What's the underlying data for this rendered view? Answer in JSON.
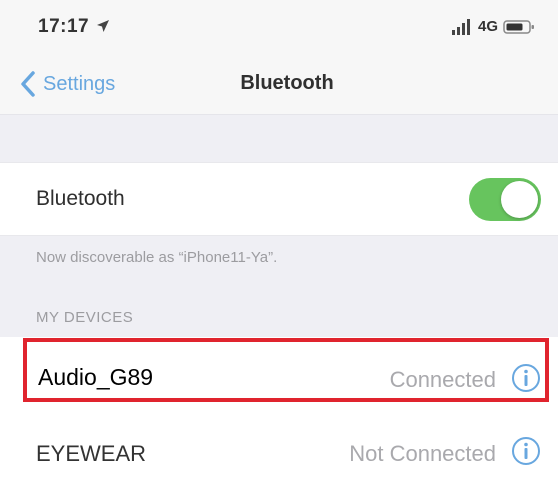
{
  "status_bar": {
    "time": "17:17",
    "network": "4G",
    "icons": [
      "location-arrow-icon",
      "signal-icon",
      "battery-icon"
    ]
  },
  "nav": {
    "back_label": "Settings",
    "title": "Bluetooth"
  },
  "bluetooth": {
    "label": "Bluetooth",
    "enabled": true,
    "discoverable_text": "Now discoverable as “iPhone11-Ya”."
  },
  "devices": {
    "section_title": "MY DEVICES",
    "items": [
      {
        "name": "Audio_G89",
        "status": "Connected",
        "highlighted": true
      },
      {
        "name": "EYEWEAR",
        "status": "Not Connected",
        "highlighted": false
      }
    ]
  },
  "colors": {
    "accent": "#68a7df",
    "toggle_on": "#67c45e",
    "highlight": "#e0242e",
    "secondary_text": "#a9a9ad"
  }
}
